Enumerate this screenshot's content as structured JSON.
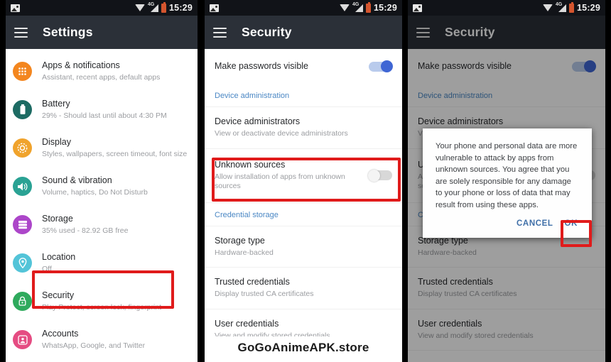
{
  "statusbar": {
    "time": "15:29",
    "network_label": "4G",
    "icons": [
      "image-icon",
      "wifi-icon",
      "signal-icon",
      "battery-icon"
    ]
  },
  "phone1": {
    "appbar": {
      "title": "Settings",
      "menu_icon": "hamburger-icon"
    },
    "items": [
      {
        "title": "Apps & notifications",
        "subtitle": "Assistant, recent apps, default apps",
        "icon": "apps-grid-icon",
        "color": "#f3861f"
      },
      {
        "title": "Battery",
        "subtitle": "29% - Should last until about 4:30 PM",
        "icon": "battery-icon",
        "color": "#1d6b63"
      },
      {
        "title": "Display",
        "subtitle": "Styles, wallpapers, screen timeout, font size",
        "icon": "brightness-icon",
        "color": "#f0a32c"
      },
      {
        "title": "Sound & vibration",
        "subtitle": "Volume, haptics, Do Not Disturb",
        "icon": "speaker-icon",
        "color": "#2aa294"
      },
      {
        "title": "Storage",
        "subtitle": "35% used - 82.92 GB free",
        "icon": "storage-list-icon",
        "color": "#ac46c9"
      },
      {
        "title": "Location",
        "subtitle": "Off",
        "icon": "location-pin-icon",
        "color": "#53c4d8"
      },
      {
        "title": "Security",
        "subtitle": "Play Protect, screen lock, fingerprint",
        "icon": "lock-shield-icon",
        "color": "#2faa5d"
      },
      {
        "title": "Accounts",
        "subtitle": "WhatsApp, Google, and Twitter",
        "icon": "account-icon",
        "color": "#e54c82"
      }
    ],
    "highlight": "Security"
  },
  "phone2": {
    "appbar": {
      "title": "Security",
      "menu_icon": "hamburger-icon"
    },
    "rows": [
      {
        "type": "switch",
        "title": "Make passwords visible",
        "subtitle": "",
        "state": "on"
      },
      {
        "type": "header",
        "title": "Device administration"
      },
      {
        "type": "item",
        "title": "Device administrators",
        "subtitle": "View or deactivate device administrators"
      },
      {
        "type": "switch",
        "title": "Unknown sources",
        "subtitle": "Allow installation of apps from unknown sources",
        "state": "off"
      },
      {
        "type": "header",
        "title": "Credential storage"
      },
      {
        "type": "item",
        "title": "Storage type",
        "subtitle": "Hardware-backed"
      },
      {
        "type": "item",
        "title": "Trusted credentials",
        "subtitle": "Display trusted CA certificates"
      },
      {
        "type": "item",
        "title": "User credentials",
        "subtitle": "View and modify stored credentials"
      }
    ],
    "highlight": "Unknown sources"
  },
  "phone3": {
    "appbar": {
      "title": "Security",
      "menu_icon": "hamburger-icon"
    },
    "dialog": {
      "message": "Your phone and personal data are more vulnerable to attack by apps from unknown sources. You agree that you are solely responsible for any damage to your phone or loss of data that may result from using these apps.",
      "cancel_label": "CANCEL",
      "ok_label": "OK",
      "highlight": "OK"
    }
  },
  "watermark": {
    "text": "GoGoAnimeAPK.store"
  },
  "colors": {
    "appbar": "#2b3038",
    "statusbar": "#111318",
    "highlight_red": "#e01b1b",
    "section_header_blue": "#4a87c4",
    "dialog_action_blue": "#3f6fa8",
    "toggle_on": "#3f66d4"
  }
}
